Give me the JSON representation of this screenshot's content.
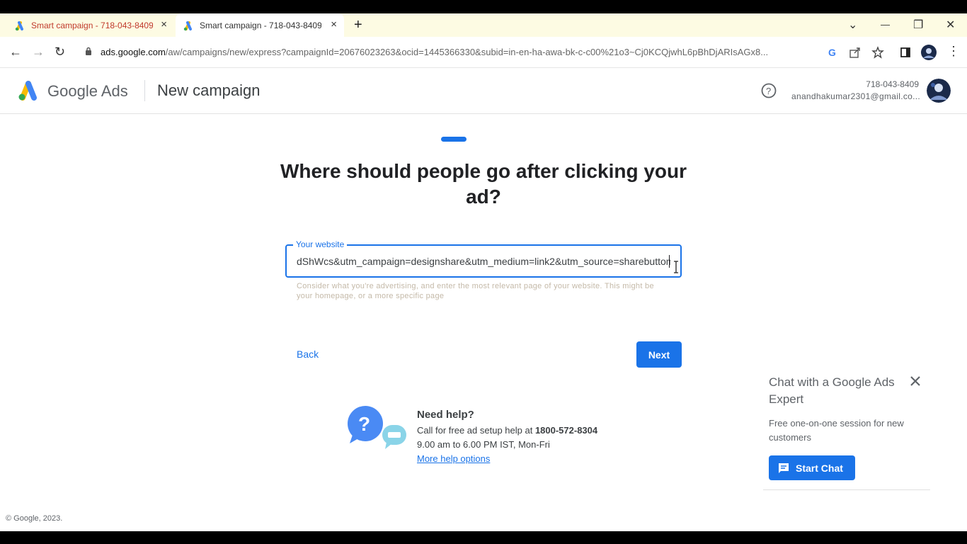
{
  "browser": {
    "tabs": [
      {
        "title": "Smart campaign - 718-043-8409",
        "close": "×"
      },
      {
        "title": "Smart campaign - 718-043-8409",
        "close": "×"
      }
    ],
    "new_tab": "+",
    "window_controls": {
      "list": "⌄",
      "minimize": "—",
      "restore": "❐",
      "close": "✕"
    },
    "nav": {
      "back": "←",
      "forward": "→",
      "reload": "↻"
    },
    "url_host": "ads.google.com",
    "url_path": "/aw/campaigns/new/express?campaignId=20676023263&ocid=1445366330&subid=in-en-ha-awa-bk-c-c00%21o3~Cj0KCQjwhL6pBhDjARIsAGx8..."
  },
  "header": {
    "brand": "Google Ads",
    "page_title": "New campaign",
    "account_phone": "718-043-8409",
    "account_email": "anandhakumar2301@gmail.co..."
  },
  "step": {
    "progress_fraction": 0.25,
    "heading": "Where should people go after clicking your ad?"
  },
  "website_field": {
    "label": "Your website",
    "value": "dShWcs&utm_campaign=designshare&utm_medium=link2&utm_source=sharebutton",
    "hint": "Consider what you're advertising, and enter the most relevant page of your website. This might be your homepage, or a more specific page"
  },
  "actions": {
    "back": "Back",
    "next": "Next"
  },
  "help": {
    "title": "Need help?",
    "call_prefix": "Call for free ad setup help at ",
    "phone": "1800-572-8304",
    "hours": "9.00 am to 6.00 PM IST, Mon-Fri",
    "more_link": "More help options"
  },
  "chat": {
    "title": "Chat with a Google Ads Expert",
    "subtitle": "Free one-on-one session for new customers",
    "button": "Start Chat"
  },
  "footer": {
    "copyright": "© Google, 2023."
  },
  "colors": {
    "accent": "#1a73e8",
    "text": "#3c4043",
    "tab_bar": "#fdfbe3"
  }
}
